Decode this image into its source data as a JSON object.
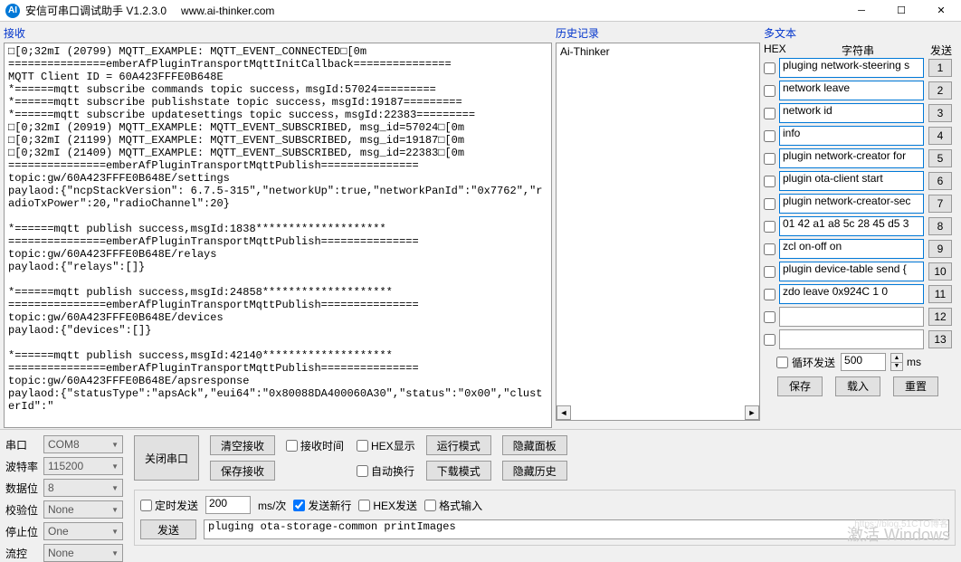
{
  "window": {
    "title": "安信可串口调试助手 V1.2.3.0",
    "url": "www.ai-thinker.com"
  },
  "labels": {
    "receive": "接收",
    "history": "历史记录",
    "multitext": "多文本",
    "hex_col": "HEX",
    "string_col": "字符串",
    "send_col": "发送",
    "loop_send": "循环发送",
    "ms": "ms",
    "save": "保存",
    "load": "载入",
    "reset": "重置",
    "serial": "串口",
    "baud": "波特率",
    "databits": "数据位",
    "parity": "校验位",
    "stopbits": "停止位",
    "flow": "流控",
    "close_port": "关闭串口",
    "clear_recv": "清空接收",
    "save_recv": "保存接收",
    "recv_time": "接收时间",
    "hex_disp": "HEX显示",
    "auto_wrap": "自动换行",
    "run_mode": "运行模式",
    "download_mode": "下载模式",
    "hide_panel": "隐藏面板",
    "hide_history": "隐藏历史",
    "timed_send": "定时发送",
    "ms_per": "ms/次",
    "send_newline": "发送新行",
    "hex_send": "HEX发送",
    "format_input": "格式输入",
    "send": "发送"
  },
  "receive_text": "□[0;32mI (20799) MQTT_EXAMPLE: MQTT_EVENT_CONNECTED□[0m\n===============emberAfPluginTransportMqttInitCallback===============\nMQTT Client ID = 60A423FFFE0B648E\n*======mqtt subscribe commands topic success，msgId:57024=========\n*======mqtt subscribe publishstate topic success，msgId:19187=========\n*======mqtt subscribe updatesettings topic success，msgId:22383=========\n□[0;32mI (20919) MQTT_EXAMPLE: MQTT_EVENT_SUBSCRIBED, msg_id=57024□[0m\n□[0;32mI (21199) MQTT_EXAMPLE: MQTT_EVENT_SUBSCRIBED, msg_id=19187□[0m\n□[0;32mI (21409) MQTT_EXAMPLE: MQTT_EVENT_SUBSCRIBED, msg_id=22383□[0m\n===============emberAfPluginTransportMqttPublish===============\ntopic:gw/60A423FFFE0B648E/settings\npaylaod:{\"ncpStackVersion\": 6.7.5-315\",\"networkUp\":true,\"networkPanId\":\"0x7762\",\"radioTxPower\":20,\"radioChannel\":20}\n\n*======mqtt publish success,msgId:1838********************\n===============emberAfPluginTransportMqttPublish===============\ntopic:gw/60A423FFFE0B648E/relays\npaylaod:{\"relays\":[]}\n\n*======mqtt publish success,msgId:24858********************\n===============emberAfPluginTransportMqttPublish===============\ntopic:gw/60A423FFFE0B648E/devices\npaylaod:{\"devices\":[]}\n\n*======mqtt publish success,msgId:42140********************\n===============emberAfPluginTransportMqttPublish===============\ntopic:gw/60A423FFFE0B648E/apsresponse\npaylaod:{\"statusType\":\"apsAck\",\"eui64\":\"0x80088DA400060A30\",\"status\":\"0x00\",\"clusterId\":\"",
  "history": {
    "item1": "Ai-Thinker"
  },
  "multi": {
    "rows": [
      {
        "text": "pluging network-steering s",
        "btn": "1"
      },
      {
        "text": "network leave",
        "btn": "2"
      },
      {
        "text": "network id",
        "btn": "3"
      },
      {
        "text": "info",
        "btn": "4"
      },
      {
        "text": "plugin network-creator for",
        "btn": "5"
      },
      {
        "text": "plugin ota-client start",
        "btn": "6"
      },
      {
        "text": "plugin network-creator-sec",
        "btn": "7"
      },
      {
        "text": "01 42 a1 a8 5c 28 45 d5 3",
        "btn": "8"
      },
      {
        "text": "zcl on-off on",
        "btn": "9"
      },
      {
        "text": "plugin device-table send {",
        "btn": "10"
      },
      {
        "text": "zdo leave 0x924C 1 0",
        "btn": "11"
      },
      {
        "text": "",
        "btn": "12"
      },
      {
        "text": "",
        "btn": "13"
      }
    ],
    "loop_ms": "500"
  },
  "serial": {
    "port": "COM8",
    "baud": "115200",
    "databits": "8",
    "parity": "None",
    "stopbits": "One",
    "flow": "None"
  },
  "send": {
    "interval": "200",
    "input": "pluging ota-storage-common printImages"
  },
  "watermark": "激活 Windows",
  "watermark2": "https://blog.51CTO博客"
}
